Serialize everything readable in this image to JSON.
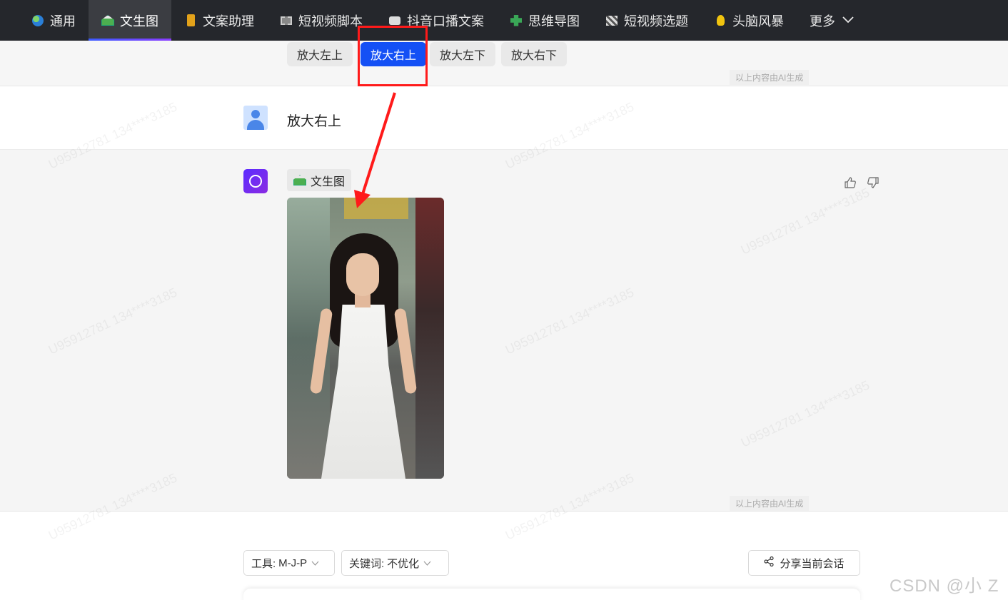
{
  "nav": {
    "items": [
      {
        "label": "通用",
        "icon": "globe-icon"
      },
      {
        "label": "文生图",
        "icon": "house-image-icon",
        "active": true
      },
      {
        "label": "文案助理",
        "icon": "book-icon"
      },
      {
        "label": "短视频脚本",
        "icon": "film-icon"
      },
      {
        "label": "抖音口播文案",
        "icon": "phone-icon"
      },
      {
        "label": "思维导图",
        "icon": "puzzle-icon"
      },
      {
        "label": "短视频选题",
        "icon": "clapper-icon"
      },
      {
        "label": "头脑风暴",
        "icon": "bulb-icon"
      },
      {
        "label": "更多",
        "icon": "chevron-down-icon"
      }
    ]
  },
  "upscale": {
    "buttons": [
      "放大左上",
      "放大右上",
      "放大左下",
      "放大右下"
    ],
    "selected": "放大右上",
    "ai_note": "以上内容由AI生成"
  },
  "user_message": {
    "text": "放大右上",
    "avatar": "user-avatar-icon"
  },
  "bot_message": {
    "tag": "文生图",
    "ai_note": "以上内容由AI生成",
    "like_icon": "thumbs-up-icon",
    "dislike_icon": "thumbs-down-icon"
  },
  "toolbar": {
    "tool_label": "工具: ",
    "tool_value": "M-J-P",
    "keyword_label": "关键词: ",
    "keyword_value": "不优化",
    "share_label": "分享当前会话"
  },
  "watermark": {
    "text": "U95912781 134****3185"
  },
  "site_watermark": "CSDN @小 Z",
  "colors": {
    "nav_bg": "#25272c",
    "accent": "#1450f5",
    "highlight": "#ff1a1a"
  }
}
